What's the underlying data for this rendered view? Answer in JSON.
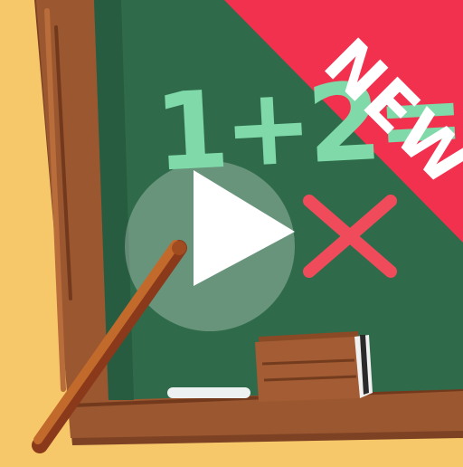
{
  "board": {
    "equation": "1+2=",
    "answer_mark": "wrong-x-icon",
    "colors": {
      "chalkboard": "#2f6b4a",
      "frame": "#8c4f2b",
      "chalk_text": "#7fd9a8",
      "wrong_mark": "#f04b5b",
      "background": "#f7c86a"
    }
  },
  "badge": {
    "label": "NEW",
    "color": "#f2314f"
  },
  "play_button": {
    "icon": "play-icon"
  }
}
